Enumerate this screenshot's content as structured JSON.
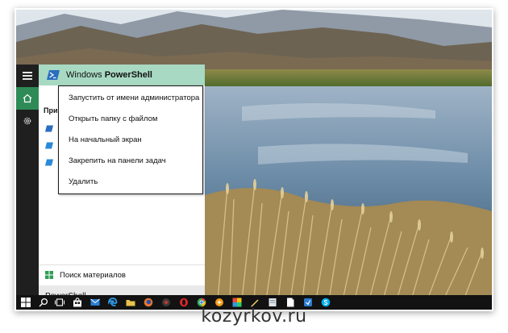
{
  "start_menu": {
    "best_match": {
      "label_prefix": "Windows ",
      "label_bold": "PowerShell",
      "icon": "powershell-icon"
    },
    "section_header": "При",
    "search_materials": {
      "label": "Поиск материалов",
      "icon": "windows-logo-icon"
    },
    "search_box": {
      "text": "PowerShell"
    }
  },
  "context_menu": {
    "items": [
      {
        "label": "Запустить от имени администратора"
      },
      {
        "label": "Открыть папку с файлом"
      },
      {
        "label": "На начальный экран"
      },
      {
        "label": "Закрепить на панели задач"
      },
      {
        "label": "Удалить"
      }
    ]
  },
  "taskbar": {
    "icons": [
      "start-icon",
      "search-icon",
      "task-view-icon",
      "store-icon",
      "mail-icon",
      "edge-icon",
      "explorer-icon",
      "firefox-icon",
      "app-icon",
      "opera-icon",
      "chrome-icon",
      "app-icon",
      "paint-icon",
      "pen-icon",
      "app-icon",
      "document-icon",
      "app-icon",
      "skype-icon"
    ]
  },
  "watermark": {
    "text": "kozyrkov.ru"
  },
  "colors": {
    "accent": "#2e8b57",
    "best_match_bg": "#a8d9c2",
    "taskbar": "#121212"
  }
}
